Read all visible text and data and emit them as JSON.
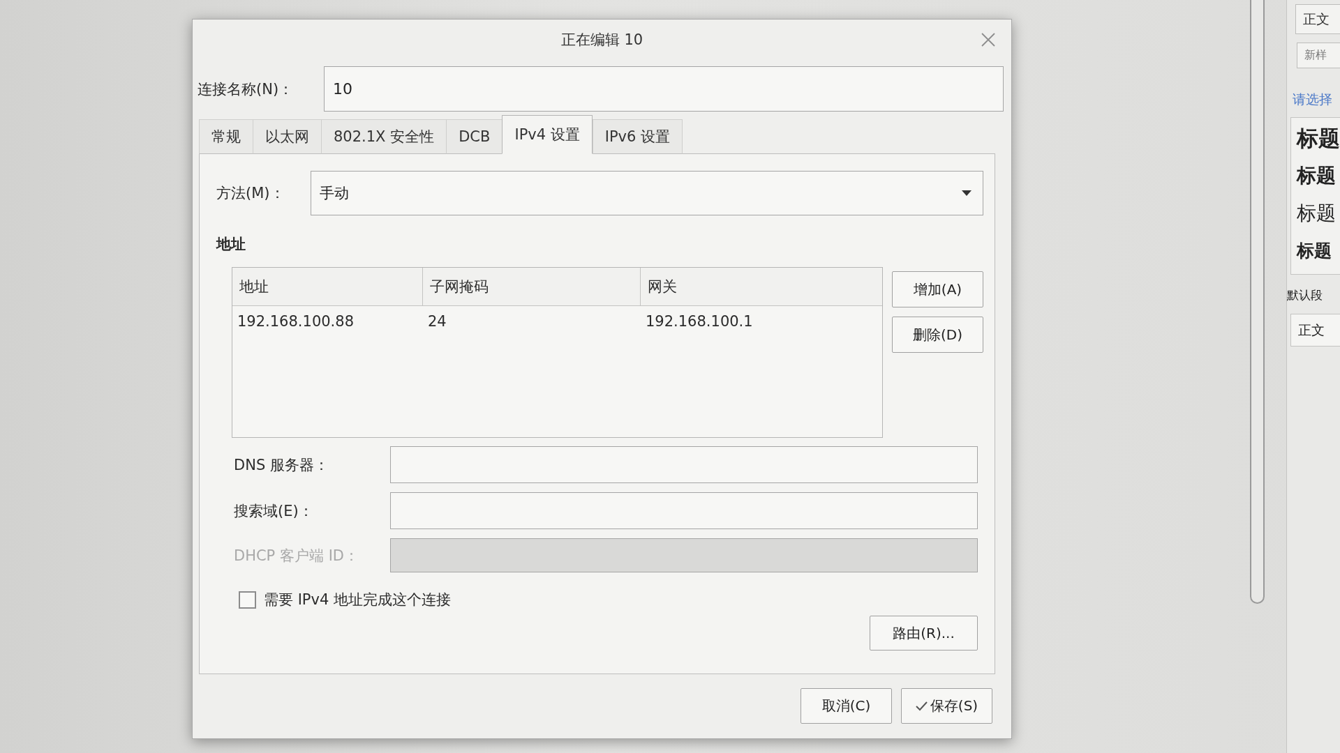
{
  "window": {
    "title": "正在编辑 10"
  },
  "connection_name": {
    "label": "连接名称(N)：",
    "value": "10"
  },
  "tabs": [
    {
      "label": "常规",
      "selected": false
    },
    {
      "label": "以太网",
      "selected": false
    },
    {
      "label": "802.1X 安全性",
      "selected": false
    },
    {
      "label": "DCB",
      "selected": false
    },
    {
      "label": "IPv4 设置",
      "selected": true
    },
    {
      "label": "IPv6 设置",
      "selected": false
    }
  ],
  "method": {
    "label": "方法(M)：",
    "value": "手动"
  },
  "addresses": {
    "title": "地址",
    "columns": [
      "地址",
      "子网掩码",
      "网关"
    ],
    "rows": [
      [
        "192.168.100.88",
        "24",
        "192.168.100.1"
      ]
    ],
    "buttons": [
      "增加(A)",
      "删除(D)"
    ]
  },
  "fields": [
    {
      "label": "DNS 服务器：",
      "disabled": false
    },
    {
      "label": "搜索域(E)：",
      "disabled": false
    },
    {
      "label": "DHCP 客户端 ID：",
      "disabled": true
    }
  ],
  "require_ipv4": {
    "label": "需要 IPv4 地址完成这个连接",
    "checked": false
  },
  "routes_button": "路由(R)...",
  "footer_buttons": [
    {
      "label": "取消(C)",
      "kind": "cancel"
    },
    {
      "label": "保存(S)",
      "kind": "save"
    }
  ],
  "side_panel": {
    "top_buttons": [
      {
        "label": "正文",
        "kind": "current"
      },
      {
        "label": "新样",
        "kind": "new"
      }
    ],
    "prompt": "请选择",
    "styles": [
      {
        "label": "标题",
        "kind": "heading1"
      },
      {
        "label": "标题",
        "kind": "heading2"
      },
      {
        "label": "标题",
        "kind": "heading3"
      },
      {
        "label": "标题",
        "kind": "heading4"
      },
      {
        "label": "默认段",
        "kind": "caption"
      },
      {
        "label": "正文",
        "kind": "body"
      }
    ]
  }
}
